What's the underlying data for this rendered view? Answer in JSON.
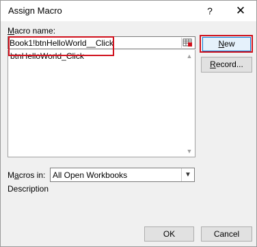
{
  "window": {
    "title": "Assign Macro",
    "help": "?",
    "close": "✕"
  },
  "macro_name": {
    "label_prefix": "M",
    "label_rest": "acro name:",
    "value": "Book1!btnHelloWorld__Click"
  },
  "macro_list": {
    "items": [
      "btnHelloWorld_Click"
    ]
  },
  "buttons": {
    "new_u": "N",
    "new_rest": "ew",
    "record_u": "R",
    "record_rest": "ecord...",
    "ok": "OK",
    "cancel": "Cancel"
  },
  "macros_in": {
    "label_pre": "M",
    "label_u": "a",
    "label_rest": "cros in:",
    "value": "All Open Workbooks"
  },
  "description": {
    "label": "Description"
  },
  "colors": {
    "highlight": "#d0101c",
    "focus": "#0078d7"
  }
}
